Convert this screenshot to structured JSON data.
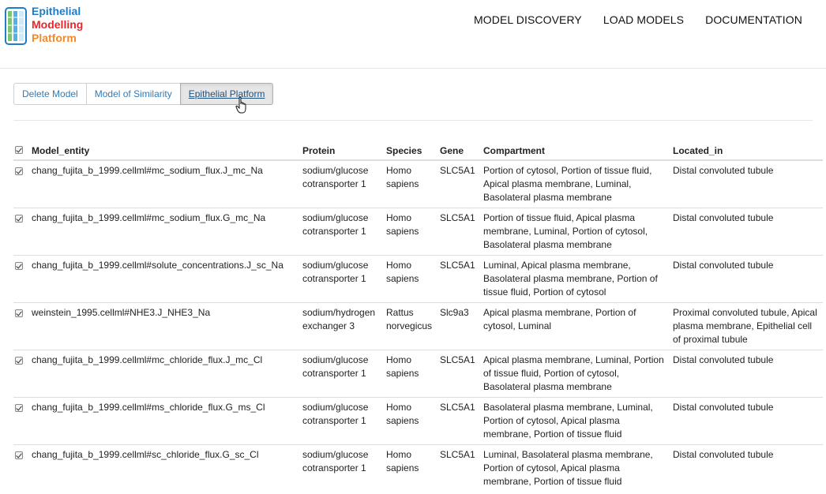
{
  "brand": {
    "line1": "Epithelial",
    "line2": "Modelling",
    "line3": "Platform",
    "colors": {
      "line1": "#1f7dc8",
      "line2": "#e8262b",
      "line3": "#f08a2c"
    }
  },
  "nav": {
    "items": [
      {
        "label": "MODEL DISCOVERY"
      },
      {
        "label": "LOAD MODELS"
      },
      {
        "label": "DOCUMENTATION"
      }
    ]
  },
  "actions": {
    "delete_label": "Delete Model",
    "similarity_label": "Model of Similarity",
    "platform_label": "Epithelial Platform"
  },
  "table": {
    "headers": {
      "entity": "Model_entity",
      "protein": "Protein",
      "species": "Species",
      "gene": "Gene",
      "compartment": "Compartment",
      "located_in": "Located_in"
    },
    "rows": [
      {
        "entity": "chang_fujita_b_1999.cellml#mc_sodium_flux.J_mc_Na",
        "protein": "sodium/glucose cotransporter 1",
        "species": "Homo sapiens",
        "gene": "SLC5A1",
        "compartment": "Portion of cytosol, Portion of tissue fluid, Apical plasma membrane, Luminal, Basolateral plasma membrane",
        "located_in": "Distal convoluted tubule"
      },
      {
        "entity": "chang_fujita_b_1999.cellml#mc_sodium_flux.G_mc_Na",
        "protein": "sodium/glucose cotransporter 1",
        "species": "Homo sapiens",
        "gene": "SLC5A1",
        "compartment": "Portion of tissue fluid, Apical plasma membrane, Luminal, Portion of cytosol, Basolateral plasma membrane",
        "located_in": "Distal convoluted tubule"
      },
      {
        "entity": "chang_fujita_b_1999.cellml#solute_concentrations.J_sc_Na",
        "protein": "sodium/glucose cotransporter 1",
        "species": "Homo sapiens",
        "gene": "SLC5A1",
        "compartment": "Luminal, Apical plasma membrane, Basolateral plasma membrane, Portion of tissue fluid, Portion of cytosol",
        "located_in": "Distal convoluted tubule"
      },
      {
        "entity": "weinstein_1995.cellml#NHE3.J_NHE3_Na",
        "protein": "sodium/hydrogen exchanger 3",
        "species": "Rattus norvegicus",
        "gene": "Slc9a3",
        "compartment": "Apical plasma membrane, Portion of cytosol, Luminal",
        "located_in": "Proximal convoluted tubule, Apical plasma membrane, Epithelial cell of proximal tubule"
      },
      {
        "entity": "chang_fujita_b_1999.cellml#mc_chloride_flux.J_mc_Cl",
        "protein": "sodium/glucose cotransporter 1",
        "species": "Homo sapiens",
        "gene": "SLC5A1",
        "compartment": "Apical plasma membrane, Luminal, Portion of tissue fluid, Portion of cytosol, Basolateral plasma membrane",
        "located_in": "Distal convoluted tubule"
      },
      {
        "entity": "chang_fujita_b_1999.cellml#ms_chloride_flux.G_ms_Cl",
        "protein": "sodium/glucose cotransporter 1",
        "species": "Homo sapiens",
        "gene": "SLC5A1",
        "compartment": "Basolateral plasma membrane, Luminal, Portion of cytosol, Apical plasma membrane, Portion of tissue fluid",
        "located_in": "Distal convoluted tubule"
      },
      {
        "entity": "chang_fujita_b_1999.cellml#sc_chloride_flux.G_sc_Cl",
        "protein": "sodium/glucose cotransporter 1",
        "species": "Homo sapiens",
        "gene": "SLC5A1",
        "compartment": "Luminal, Basolateral plasma membrane, Portion of cytosol, Apical plasma membrane, Portion of tissue fluid",
        "located_in": "Distal convoluted tubule"
      }
    ]
  }
}
